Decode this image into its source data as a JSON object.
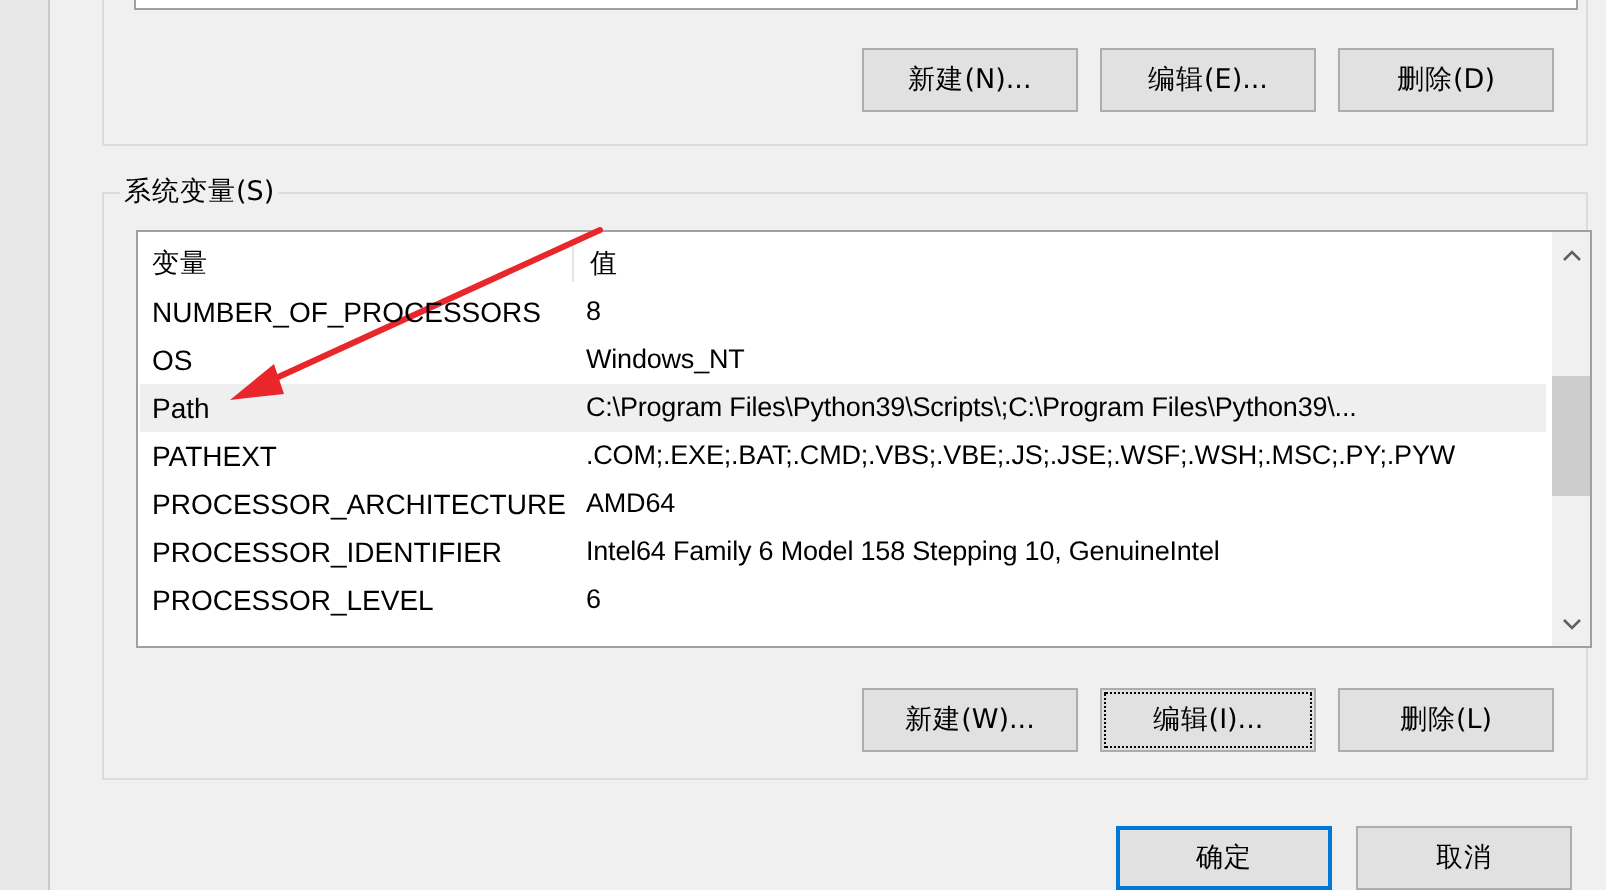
{
  "user_buttons": [
    {
      "label": "新建(N)...",
      "focused": false
    },
    {
      "label": "编辑(E)...",
      "focused": false
    },
    {
      "label": "删除(D)",
      "focused": false
    }
  ],
  "system_variables": {
    "title": "系统变量(S)",
    "columns": [
      "变量",
      "值"
    ],
    "rows": [
      {
        "name": "NUMBER_OF_PROCESSORS",
        "value": "8",
        "selected": false
      },
      {
        "name": "OS",
        "value": "Windows_NT",
        "selected": false
      },
      {
        "name": "Path",
        "value": "C:\\Program Files\\Python39\\Scripts\\;C:\\Program Files\\Python39\\...",
        "selected": true
      },
      {
        "name": "PATHEXT",
        "value": ".COM;.EXE;.BAT;.CMD;.VBS;.VBE;.JS;.JSE;.WSF;.WSH;.MSC;.PY;.PYW",
        "selected": false
      },
      {
        "name": "PROCESSOR_ARCHITECTURE",
        "value": "AMD64",
        "selected": false
      },
      {
        "name": "PROCESSOR_IDENTIFIER",
        "value": "Intel64 Family 6 Model 158 Stepping 10, GenuineIntel",
        "selected": false
      },
      {
        "name": "PROCESSOR_LEVEL",
        "value": "6",
        "selected": false
      }
    ],
    "buttons": [
      {
        "label": "新建(W)...",
        "focused": false
      },
      {
        "label": "编辑(I)...",
        "focused": true
      },
      {
        "label": "删除(L)",
        "focused": false
      }
    ]
  },
  "dialog_buttons": [
    {
      "label": "确定",
      "default": true
    },
    {
      "label": "取消",
      "default": false
    }
  ]
}
